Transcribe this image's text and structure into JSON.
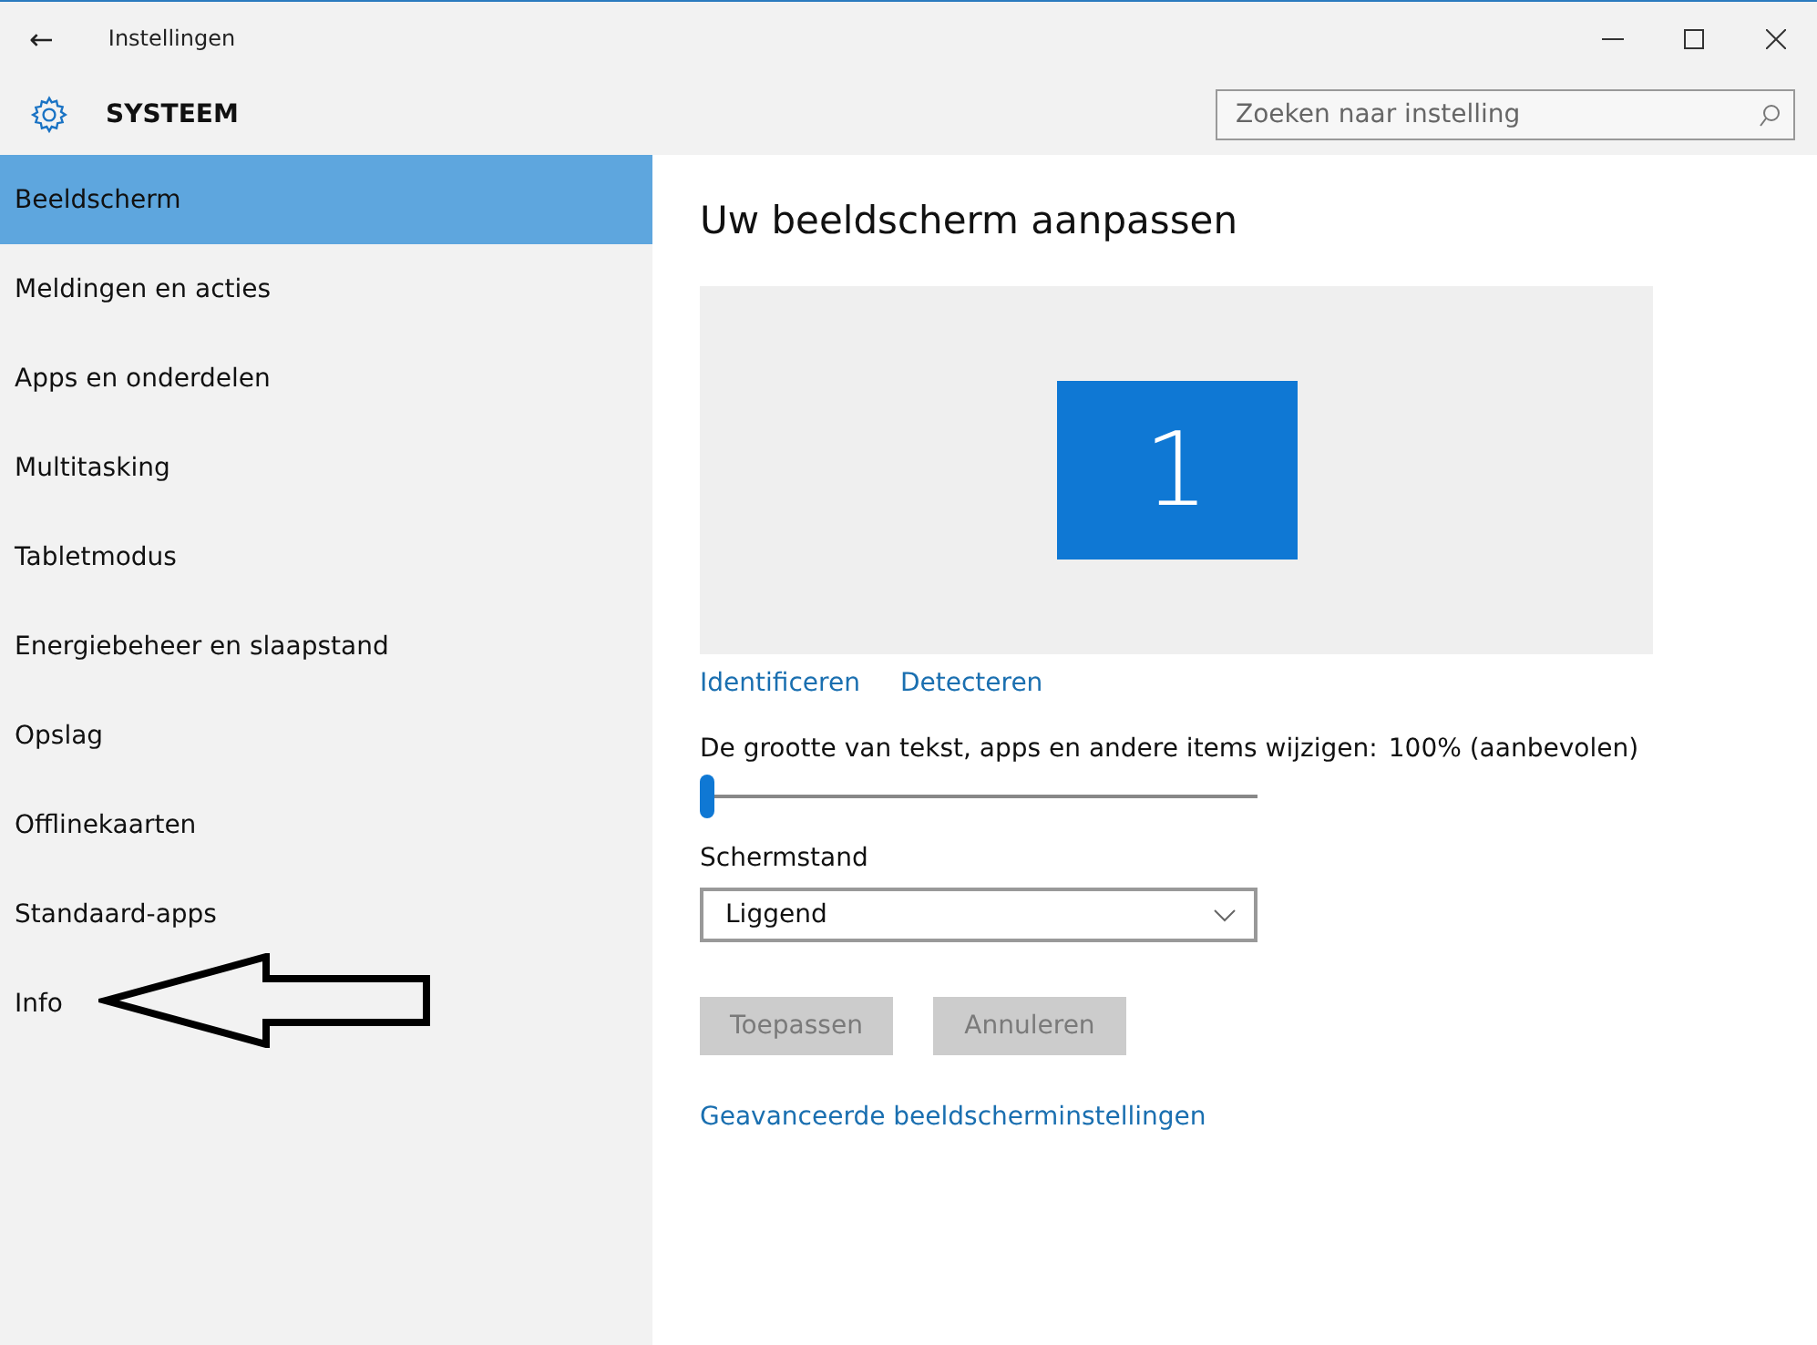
{
  "window": {
    "title": "Instellingen",
    "back": "←"
  },
  "header": {
    "title": "SYSTEEM",
    "search": {
      "placeholder": "Zoeken naar instelling"
    }
  },
  "sidebar": {
    "items": [
      {
        "label": "Beeldscherm",
        "selected": true
      },
      {
        "label": "Meldingen en acties",
        "selected": false
      },
      {
        "label": "Apps en onderdelen",
        "selected": false
      },
      {
        "label": "Multitasking",
        "selected": false
      },
      {
        "label": "Tabletmodus",
        "selected": false
      },
      {
        "label": "Energiebeheer en slaapstand",
        "selected": false
      },
      {
        "label": "Opslag",
        "selected": false
      },
      {
        "label": "Offlinekaarten",
        "selected": false
      },
      {
        "label": "Standaard-apps",
        "selected": false
      },
      {
        "label": "Info",
        "selected": false
      }
    ]
  },
  "content": {
    "heading": "Uw beeldscherm aanpassen",
    "display": {
      "number": "1"
    },
    "links": [
      "Identificeren",
      "Detecteren"
    ],
    "scale": {
      "label": "De grootte van tekst, apps en andere items wijzigen:",
      "value": "100% (aanbevolen)",
      "level": 0
    },
    "orientation": {
      "label": "Schermstand",
      "value": "Liggend"
    },
    "buttons": [
      {
        "label": "Toepassen",
        "disabled": true
      },
      {
        "label": "Annuleren",
        "disabled": true
      }
    ],
    "advanced_link": "Geavanceerde beeldscherminstellingen"
  }
}
